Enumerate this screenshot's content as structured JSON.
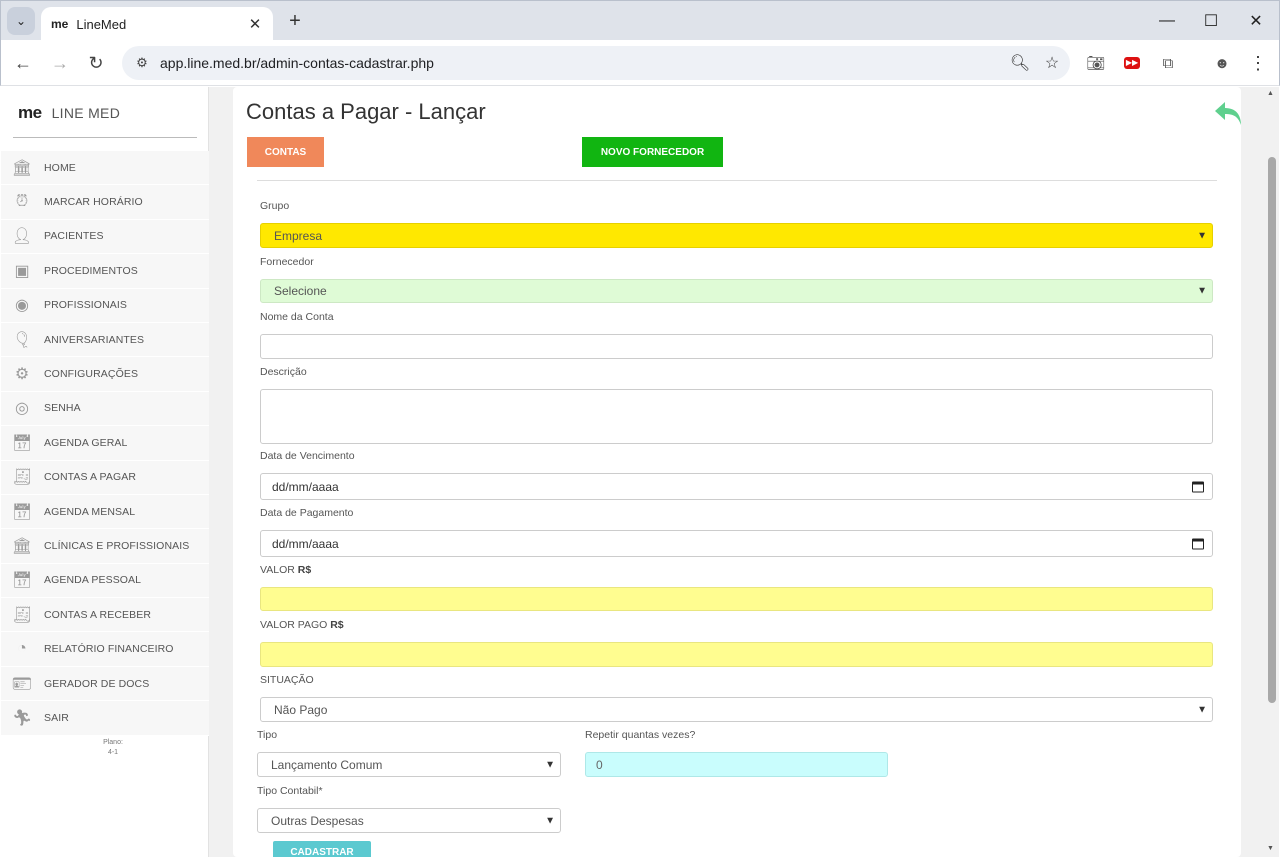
{
  "browser": {
    "tab_title": "LineMed",
    "tab_favicon": "me",
    "url": "app.line.med.br/admin-contas-cadastrar.php"
  },
  "brand": {
    "logo": "me",
    "name": "LINE MED"
  },
  "sidebar": {
    "items": [
      {
        "label": "HOME",
        "icon": "bank-icon"
      },
      {
        "label": "MARCAR HORÁRIO",
        "icon": "alarm-clock-icon"
      },
      {
        "label": "PACIENTES",
        "icon": "user-icon"
      },
      {
        "label": "PROCEDIMENTOS",
        "icon": "box-icon"
      },
      {
        "label": "PROFISSIONAIS",
        "icon": "user-circle-icon"
      },
      {
        "label": "ANIVERSARIANTES",
        "icon": "balloon-icon"
      },
      {
        "label": "CONFIGURAÇÕES",
        "icon": "gear-icon"
      },
      {
        "label": "SENHA",
        "icon": "fingerprint-icon"
      },
      {
        "label": "AGENDA GERAL",
        "icon": "calendar-icon"
      },
      {
        "label": "CONTAS A PAGAR",
        "icon": "bill-coins-icon"
      },
      {
        "label": "AGENDA MENSAL",
        "icon": "calendar-icon"
      },
      {
        "label": "CLÍNICAS E PROFISSIONAIS",
        "icon": "bank-icon"
      },
      {
        "label": "AGENDA PESSOAL",
        "icon": "calendar-icon"
      },
      {
        "label": "CONTAS A RECEBER",
        "icon": "bill-coins-icon"
      },
      {
        "label": "RELATÓRIO FINANCEIRO",
        "icon": "pie-chart-icon"
      },
      {
        "label": "GERADOR DE DOCS",
        "icon": "id-card-icon"
      },
      {
        "label": "SAIR",
        "icon": "runner-icon"
      }
    ],
    "plan_label": "Plano:",
    "plan_value": "4-1"
  },
  "page": {
    "title": "Contas a Pagar - Lançar",
    "btn_contas": "CONTAS",
    "btn_novo_fornecedor": "NOVO FORNECEDOR"
  },
  "form": {
    "grupo_label": "Grupo",
    "grupo_value": "Empresa",
    "fornecedor_label": "Fornecedor",
    "fornecedor_value": "Selecione",
    "nome_label": "Nome da Conta",
    "nome_value": "",
    "descricao_label": "Descrição",
    "descricao_value": "",
    "vencimento_label": "Data de Vencimento",
    "vencimento_placeholder": "dd/mm/aaaa",
    "pagamento_label": "Data de Pagamento",
    "pagamento_placeholder": "dd/mm/aaaa",
    "valor_label": "VALOR",
    "valor_currency": "R$",
    "valor_value": "",
    "valor_pago_label": "VALOR PAGO",
    "valor_pago_currency": "R$",
    "valor_pago_value": "",
    "situacao_label": "SITUAÇÃO",
    "situacao_value": "Não Pago",
    "tipo_label": "Tipo",
    "tipo_value": "Lançamento Comum",
    "repetir_label": "Repetir quantas vezes?",
    "repetir_value": "0",
    "tipo_contabil_label": "Tipo Contabil*",
    "tipo_contabil_value": "Outras Despesas",
    "submit_label": "CADASTRAR"
  },
  "colors": {
    "grupo_bg": "#ffe800",
    "fornecedor_bg": "#dffbd6",
    "valor_bg": "#fffd90",
    "repetir_bg": "#c9fdfd",
    "btn_contas": "#f0885a",
    "btn_novo": "#11b511",
    "btn_cadastrar": "#5bc9d0",
    "back_icon": "#5fd08e"
  }
}
